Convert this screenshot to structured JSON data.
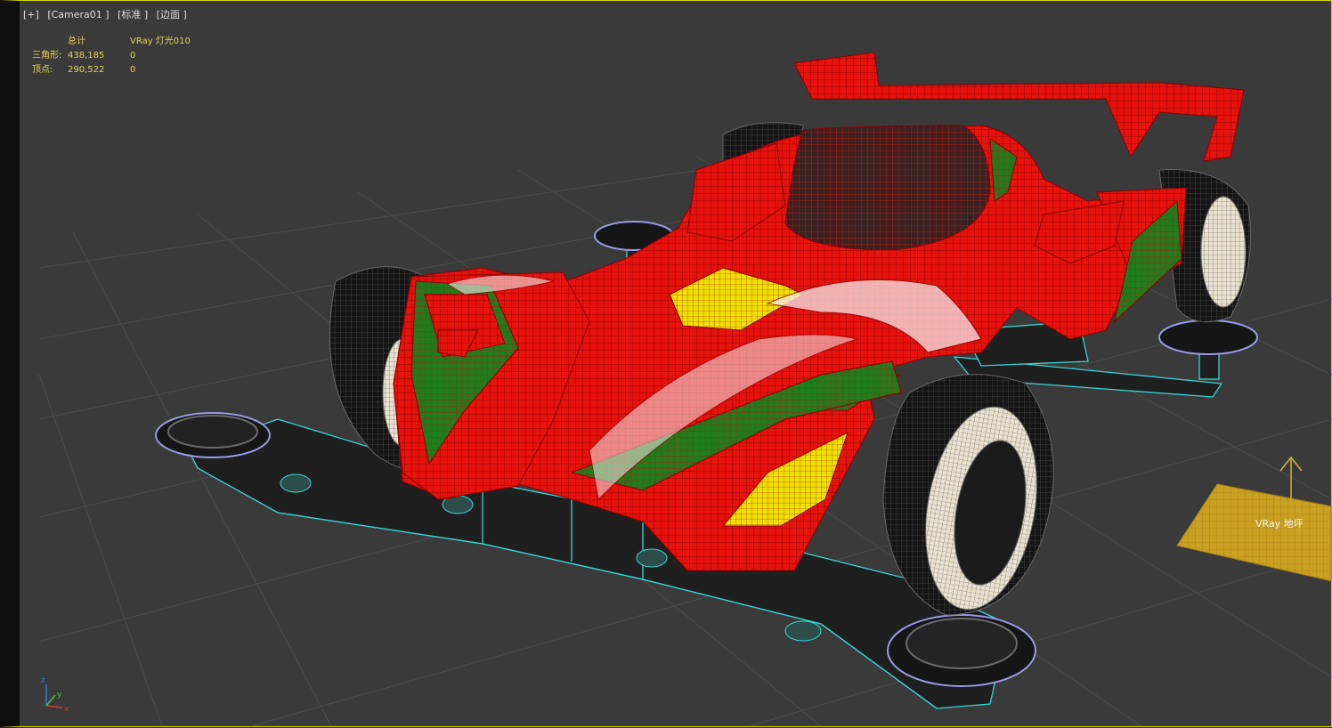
{
  "viewport": {
    "labels": [
      "[+]",
      "[Camera01 ]",
      "[标准 ]",
      "[边面 ]"
    ]
  },
  "stats": {
    "header": {
      "total": "总计",
      "selected": "VRay 灯光010"
    },
    "rows": [
      {
        "label": "三角形:",
        "total": "438,185",
        "selected": "0"
      },
      {
        "label": "顶点:",
        "total": "290,522",
        "selected": "0"
      }
    ]
  },
  "scene": {
    "ground_object_label": "VRay 地坪",
    "axis_labels": {
      "x": "x",
      "y": "y",
      "z": "z"
    }
  },
  "colors": {
    "viewport_bg": "#3a3a3a",
    "grid": "#4b4b4b",
    "body_red": "#e5120d",
    "wire_dark": "#7c0000",
    "chassis_wire": "#37d6d2",
    "stripe_green": "#1e7d1a",
    "accent_yellow": "#efe000",
    "ground_plane": "#c9a020",
    "stats_text": "#e3d35a"
  },
  "icons": [
    "world-axis-gizmo-icon",
    "vray-light-arrow-icon"
  ]
}
